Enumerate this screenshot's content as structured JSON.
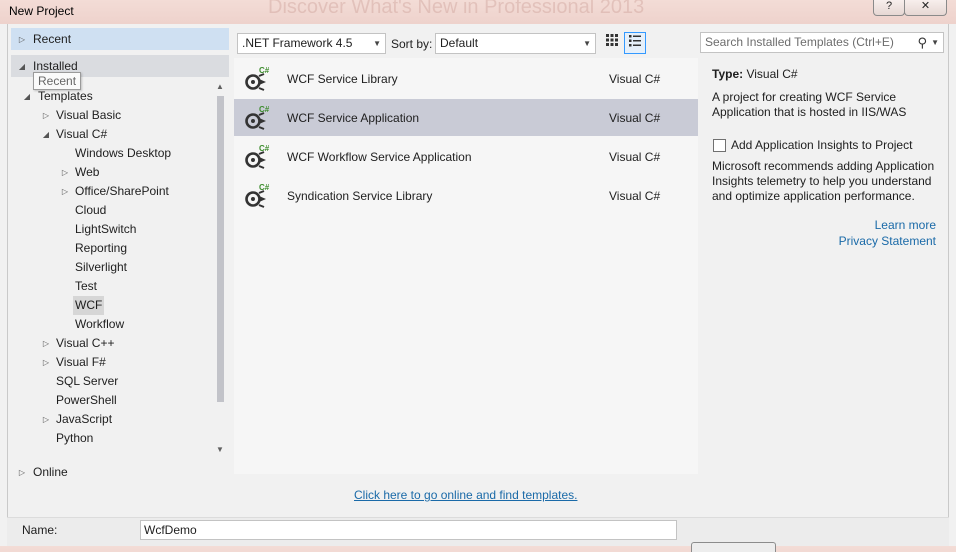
{
  "window": {
    "title": "New Project",
    "background_ghost_text": "Discover What's New in Professional 2013",
    "help_label": "?",
    "close_label": "✕"
  },
  "left": {
    "recent": "Recent",
    "installed": "Installed",
    "tooltip": "Recent",
    "templates": "Templates",
    "visual_basic": "Visual Basic",
    "visual_csharp": "Visual C#",
    "csharp_children": [
      "Windows Desktop",
      "Web",
      "Office/SharePoint",
      "Cloud",
      "LightSwitch",
      "Reporting",
      "Silverlight",
      "Test",
      "WCF",
      "Workflow"
    ],
    "visual_cpp": "Visual C++",
    "visual_fsharp": "Visual F#",
    "sql_server": "SQL Server",
    "powershell": "PowerShell",
    "javascript": "JavaScript",
    "python": "Python",
    "online": "Online"
  },
  "toolbar": {
    "framework": ".NET Framework 4.5",
    "sort_label": "Sort by:",
    "sort_value": "Default",
    "search_placeholder": "Search Installed Templates (Ctrl+E)"
  },
  "templates": [
    {
      "name": "WCF Service Library",
      "lang": "Visual C#",
      "badge": "C#"
    },
    {
      "name": "WCF Service Application",
      "lang": "Visual C#",
      "badge": "C#"
    },
    {
      "name": "WCF Workflow Service Application",
      "lang": "Visual C#",
      "badge": "C#"
    },
    {
      "name": "Syndication Service Library",
      "lang": "Visual C#",
      "badge": "C#"
    }
  ],
  "details": {
    "type_label": "Type:",
    "type_value": "Visual C#",
    "description": "A project for creating WCF Service Application that is hosted in IIS/WAS",
    "ai_label": "Add Application Insights to Project",
    "ai_note": "Microsoft recommends adding Application Insights telemetry to help you understand and optimize application performance.",
    "learn_more": "Learn more",
    "privacy": "Privacy Statement"
  },
  "online_link": "Click here to go online and find templates.",
  "form": {
    "name_label": "Name:",
    "name_value": "WcfDemo"
  },
  "colors": {
    "accent": "#3399ff",
    "link": "#1a6aa8",
    "selection": "#c9cbd6",
    "icon_green": "#3c8c2c"
  }
}
